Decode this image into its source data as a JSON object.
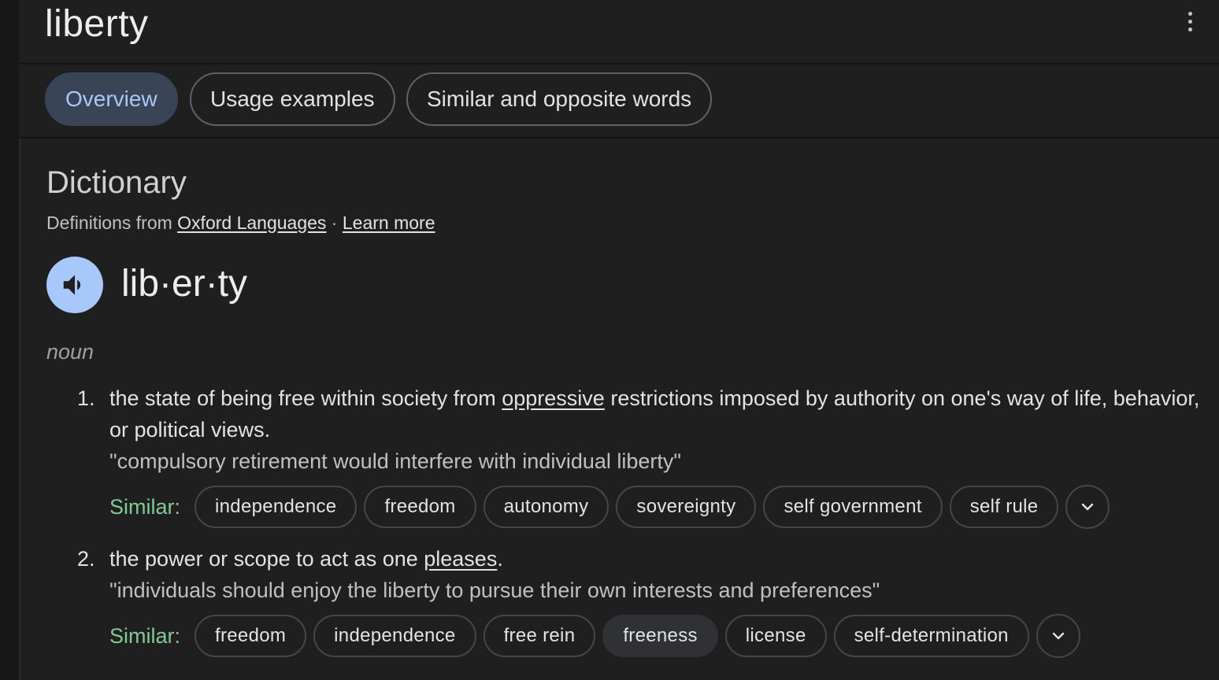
{
  "header": {
    "title": "liberty",
    "more_icon": "more-vert-icon"
  },
  "tabs": [
    {
      "label": "Overview",
      "active": true
    },
    {
      "label": "Usage examples",
      "active": false
    },
    {
      "label": "Similar and opposite words",
      "active": false
    }
  ],
  "dictionary": {
    "title": "Dictionary",
    "source_prefix": "Definitions from ",
    "source_link": "Oxford Languages",
    "separator": " · ",
    "learn_more": "Learn more",
    "audio_icon": "speaker-icon",
    "headword": "lib·er·ty",
    "part_of_speech": "noun",
    "senses": [
      {
        "number": "1.",
        "def_before": "the state of being free within society from ",
        "def_link": "oppressive",
        "def_after": " restrictions imposed by authority on one's way of life, behavior, or political views.",
        "example": "\"compulsory retirement would interfere with individual liberty\"",
        "similar_label": "Similar:",
        "similar": [
          "independence",
          "freedom",
          "autonomy",
          "sovereignty",
          "self government",
          "self rule"
        ]
      },
      {
        "number": "2.",
        "def_before": "the power or scope to act as one ",
        "def_link": "pleases",
        "def_after": ".",
        "example": "\"individuals should enjoy the liberty to pursue their own interests and preferences\"",
        "similar_label": "Similar:",
        "similar": [
          "freedom",
          "independence",
          "free rein",
          "freeness",
          "license",
          "self-determination"
        ]
      }
    ]
  },
  "colors": {
    "background": "#1f1f1f",
    "active_tab_bg": "#394457",
    "active_tab_text": "#a8c7fa",
    "similar_label": "#81c995",
    "audio_button": "#a8c7fa"
  }
}
